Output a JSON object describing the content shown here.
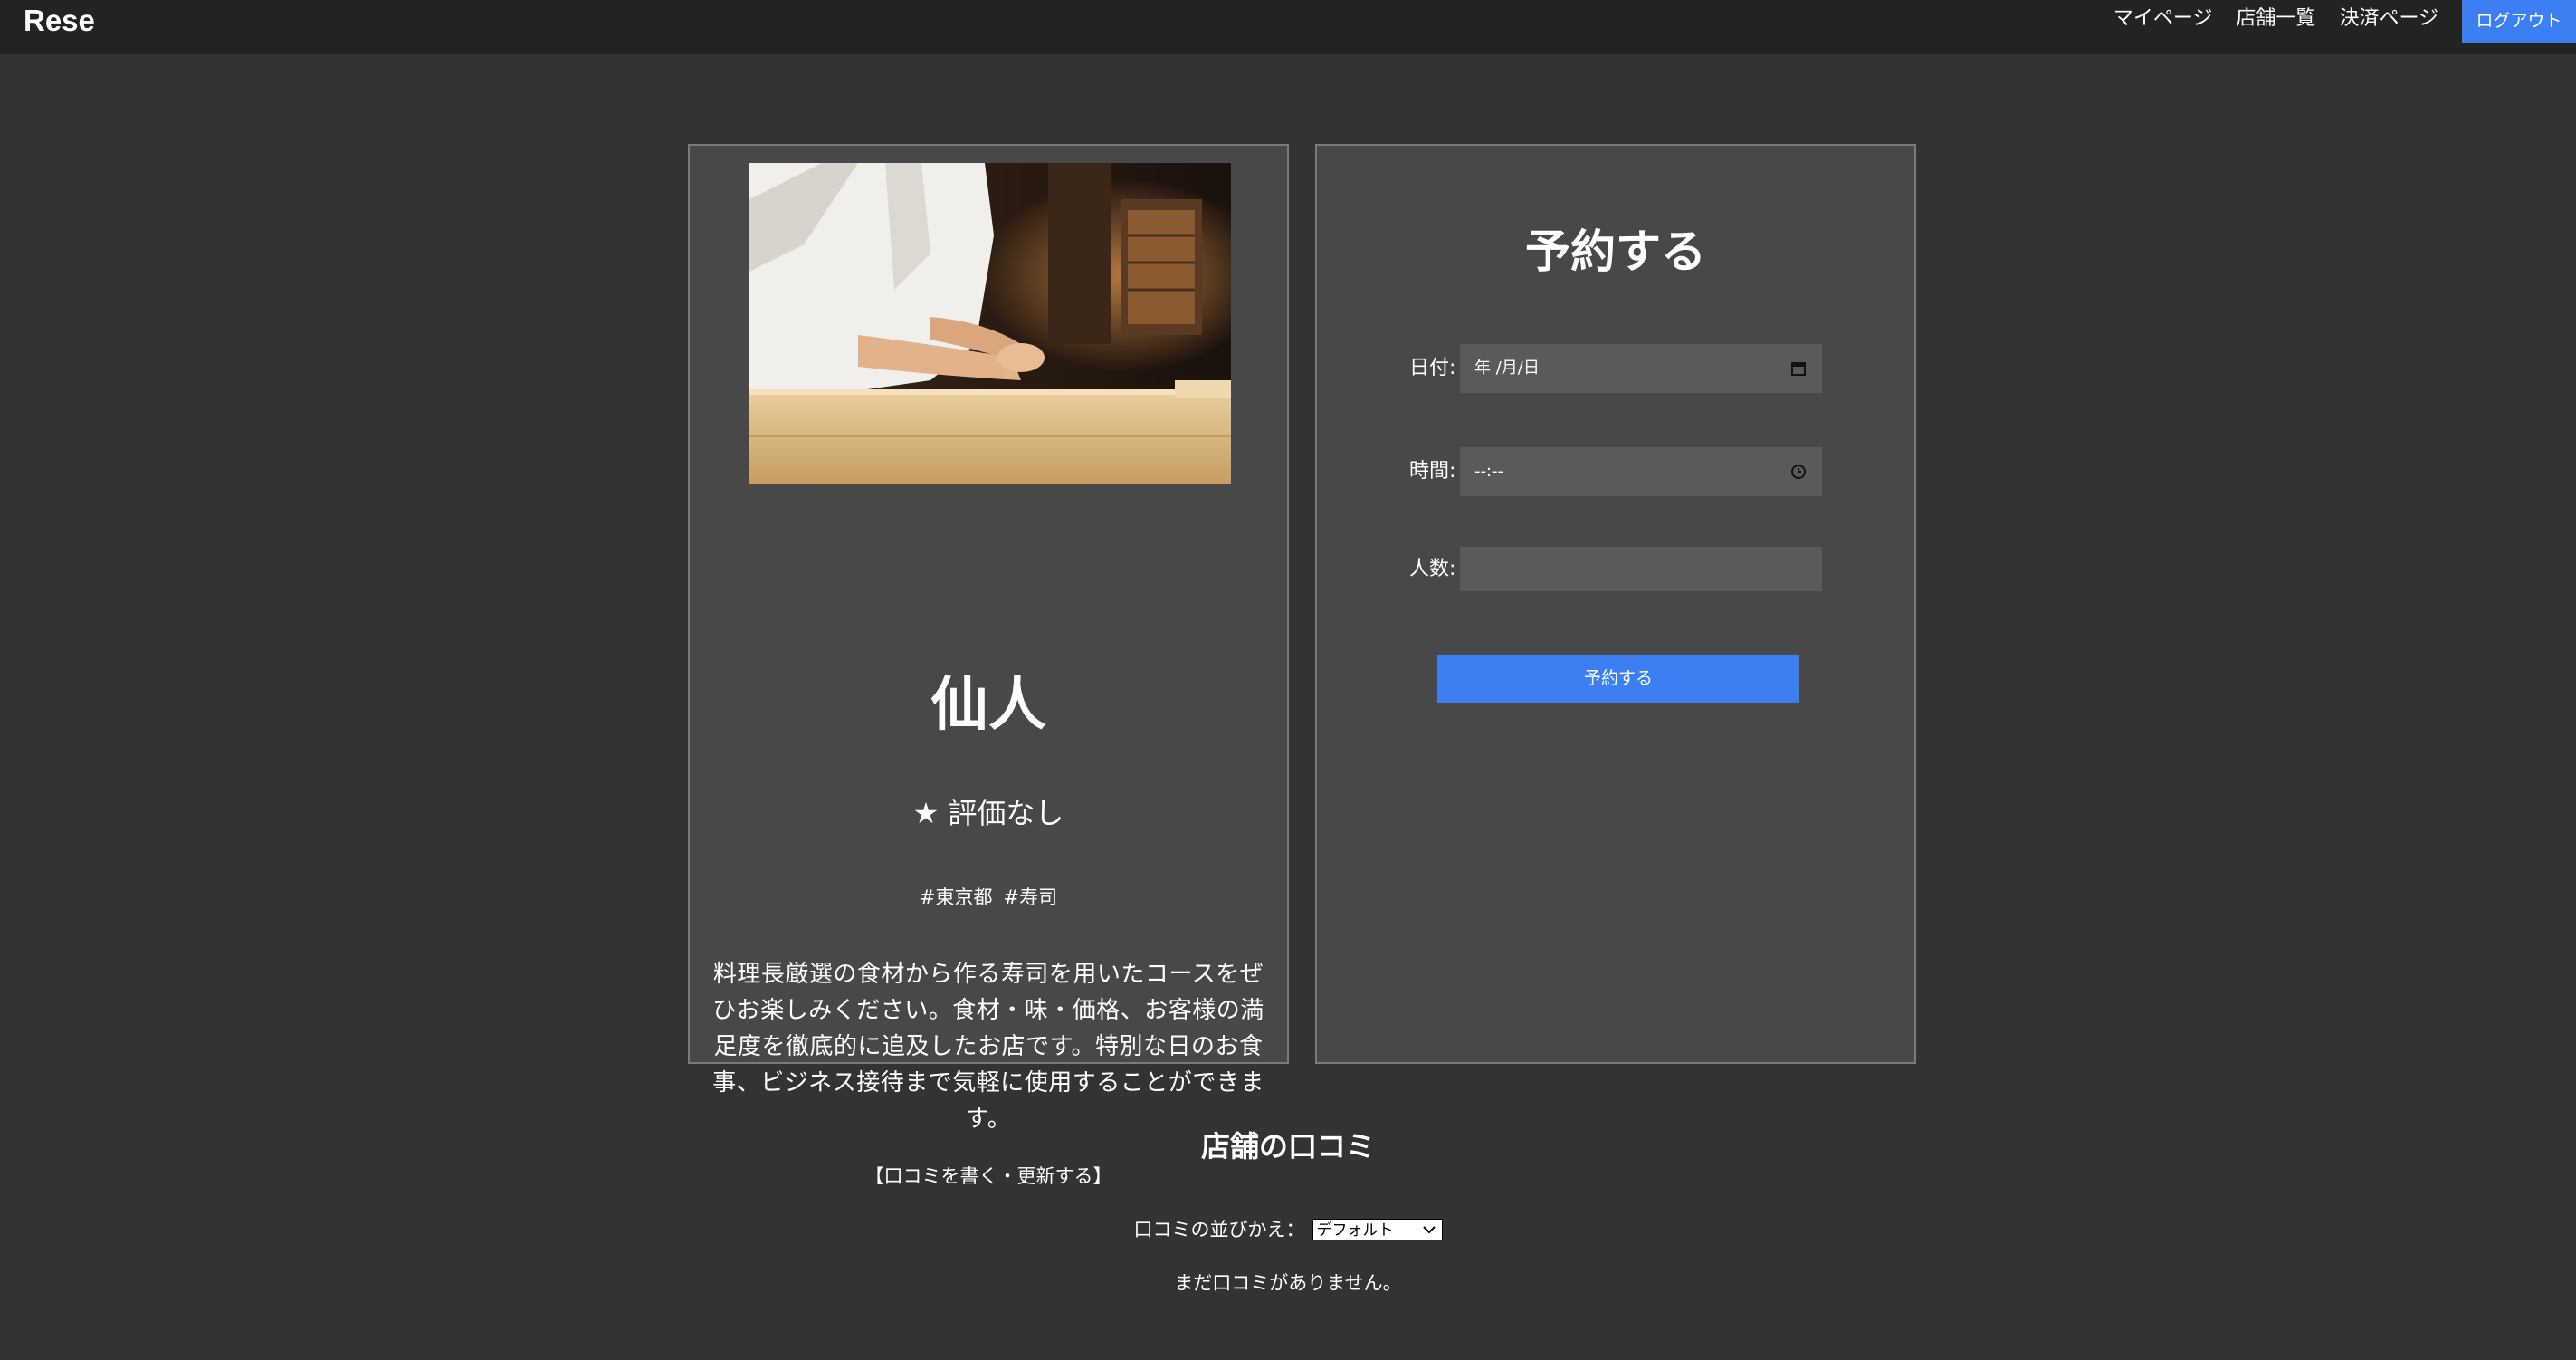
{
  "header": {
    "logo": "Rese",
    "nav": [
      "マイページ",
      "店舗一覧",
      "決済ページ"
    ],
    "logout": "ログアウト"
  },
  "shop": {
    "name": "仙人",
    "rating": "★ 評価なし",
    "tags": [
      "#東京都",
      "#寿司"
    ],
    "description": "料理長厳選の食材から作る寿司を用いたコースをぜひお楽しみください。食材・味・価格、お客様の満足度を徹底的に追及したお店です。特別な日のお食事、ビジネス接待まで気軽に使用することができます。",
    "review_link": "【口コミを書く・更新する】"
  },
  "reservation": {
    "title": "予約する",
    "date_label": "日付:",
    "date_placeholder": "年 /月/日",
    "time_label": "時間:",
    "time_placeholder": "--:--",
    "people_label": "人数:",
    "people_value": "",
    "submit": "予約する"
  },
  "reviews": {
    "title": "店舗の口コミ",
    "sort_label": "口コミの並びかえ：",
    "sort_selected": "デフォルト",
    "empty_message": "まだ口コミがありません。"
  },
  "colors": {
    "background": "#333333",
    "header": "#232323",
    "card": "#484848",
    "accent": "#3b7ff2"
  }
}
